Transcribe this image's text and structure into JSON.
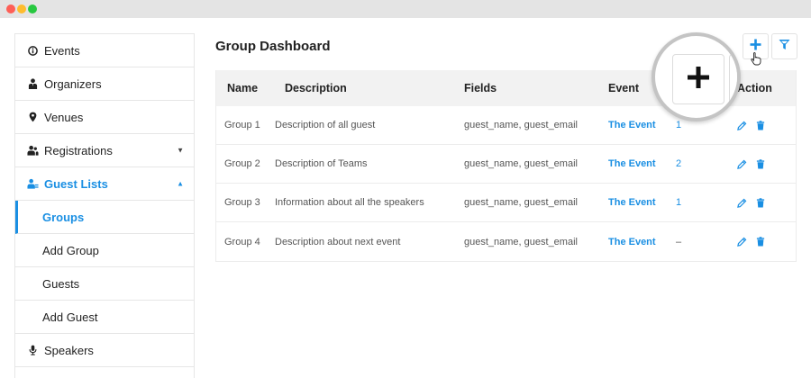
{
  "window": {
    "controls": [
      "close",
      "minimize",
      "maximize"
    ]
  },
  "sidebar": {
    "items": [
      {
        "label": "Events",
        "icon": "info-circle-icon"
      },
      {
        "label": "Organizers",
        "icon": "user-tie-icon"
      },
      {
        "label": "Venues",
        "icon": "map-pin-icon"
      },
      {
        "label": "Registrations",
        "icon": "users-icon",
        "caret": "▼"
      },
      {
        "label": "Guest Lists",
        "icon": "guest-list-icon",
        "caret": "▲",
        "active": true
      },
      {
        "label": "Groups",
        "sub": true,
        "selected": true
      },
      {
        "label": "Add Group",
        "sub": true
      },
      {
        "label": "Guests",
        "sub": true
      },
      {
        "label": "Add Guest",
        "sub": true
      },
      {
        "label": "Speakers",
        "icon": "microphone-icon"
      }
    ]
  },
  "main": {
    "title": "Group Dashboard",
    "toolbar": {
      "add_icon": "plus-icon",
      "filter_icon": "filter-icon"
    },
    "table": {
      "headers": [
        "Name",
        "Description",
        "Fields",
        "Event",
        "",
        "Action"
      ],
      "rows": [
        {
          "name": "Group 1",
          "description": "Description of all guest",
          "fields": "guest_name, guest_email",
          "event": "The Event",
          "count": "1"
        },
        {
          "name": "Group 2",
          "description": "Description of Teams",
          "fields": "guest_name, guest_email",
          "event": "The Event",
          "count": "2"
        },
        {
          "name": "Group 3",
          "description": "Information about all the speakers",
          "fields": "guest_name, guest_email",
          "event": "The Event",
          "count": "1"
        },
        {
          "name": "Group 4",
          "description": "Description about next event",
          "fields": "guest_name, guest_email",
          "event": "The Event",
          "count": "–"
        }
      ]
    },
    "magnifier": {
      "content_icon": "plus-icon"
    }
  },
  "colors": {
    "accent": "#1a8fe3",
    "border": "#e6e6e6",
    "header_bg": "#f2f2f2",
    "delete": "#1a8fe3"
  }
}
